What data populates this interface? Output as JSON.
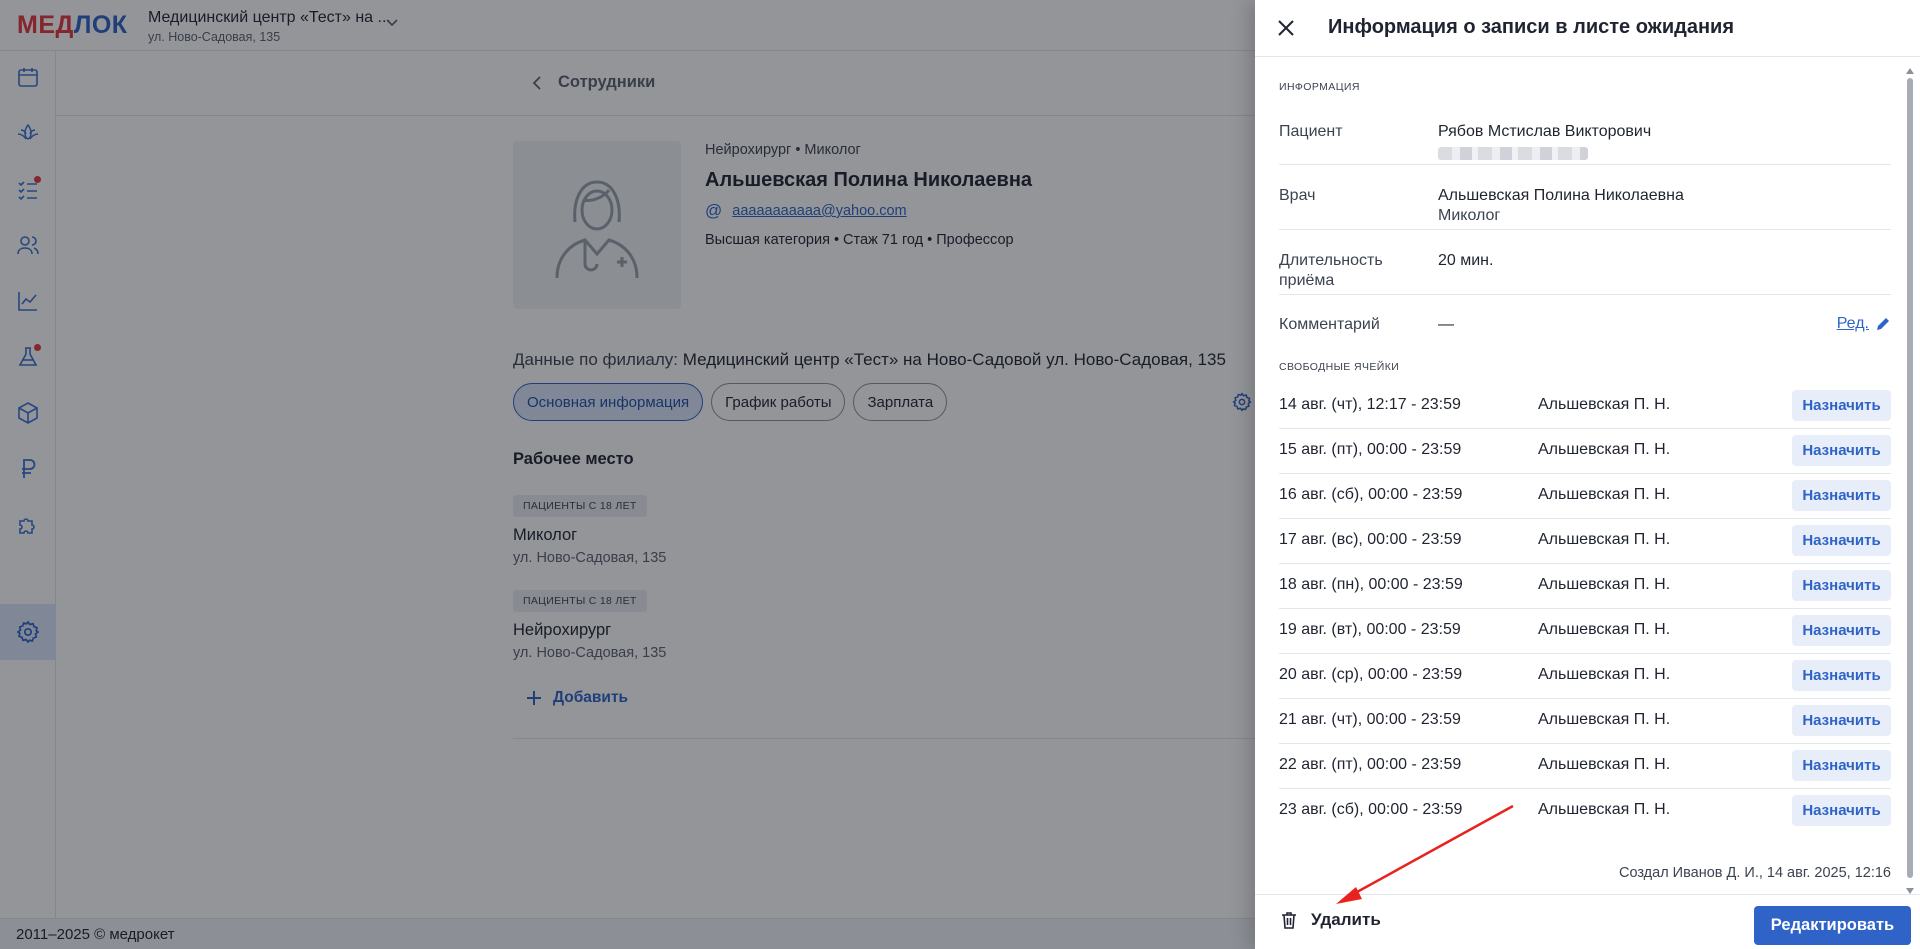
{
  "app": {
    "logo_part1": "МЕД",
    "logo_part2": "ЛОК",
    "clinic_name": "Медицинский центр «Тест» на ...",
    "clinic_address": "ул. Ново-Садовая, 135",
    "footer_text": "2011–2025 © медрокет"
  },
  "sidebar": {
    "icons": [
      "calendar-icon",
      "lotus-icon",
      "task-list-icon",
      "users-icon",
      "chart-icon",
      "flask-icon",
      "box-icon",
      "ruble-icon",
      "puzzle-icon",
      "settings-icon"
    ],
    "active": "settings-icon",
    "badges": [
      "task-list-icon",
      "flask-icon"
    ]
  },
  "employee": {
    "breadcrumb": "Сотрудники",
    "specialties": "Нейрохирург • Миколог",
    "name": "Альшевская Полина Николаевна",
    "email": "aaaaaaaaaaa@yahoo.com",
    "meta": "Высшая категория • Стаж 71 год • Профессор",
    "branch_label": "Данные по филиалу:",
    "branch_value": "Медицинский центр «Тест» на Ново-Садовой ул. Ново-Садовая, 135",
    "tabs": [
      "Основная информация",
      "График работы",
      "Зарплата"
    ],
    "workplace_title": "Рабочее место",
    "workplaces": [
      {
        "badge": "ПАЦИЕНТЫ С 18 ЛЕТ",
        "title": "Миколог",
        "address": "ул. Ново-Садовая, 135"
      },
      {
        "badge": "ПАЦИЕНТЫ С 18 ЛЕТ",
        "title": "Нейрохирург",
        "address": "ул. Ново-Садовая, 135"
      }
    ],
    "add_label": "Добавить"
  },
  "drawer": {
    "title": "Информация о записи в листе ожидания",
    "info_label": "ИНФОРМАЦИЯ",
    "patient_key": "Пациент",
    "patient_value": "Рябов Мстислав Викторович",
    "doctor_key": "Врач",
    "doctor_value": "Альшевская Полина Николаевна",
    "doctor_spec": "Миколог",
    "duration_key": "Длительность приёма",
    "duration_value": "20 мин.",
    "comment_key": "Комментарий",
    "comment_value": "—",
    "edit_label": "Ред.",
    "slots_label": "СВОБОДНЫЕ ЯЧЕЙКИ",
    "slots": [
      {
        "date": "14 авг. (чт), 12:17 - 23:59",
        "doctor": "Альшевская П. Н.",
        "action": "Назначить"
      },
      {
        "date": "15 авг. (пт), 00:00 - 23:59",
        "doctor": "Альшевская П. Н.",
        "action": "Назначить"
      },
      {
        "date": "16 авг. (сб), 00:00 - 23:59",
        "doctor": "Альшевская П. Н.",
        "action": "Назначить"
      },
      {
        "date": "17 авг. (вс), 00:00 - 23:59",
        "doctor": "Альшевская П. Н.",
        "action": "Назначить"
      },
      {
        "date": "18 авг. (пн), 00:00 - 23:59",
        "doctor": "Альшевская П. Н.",
        "action": "Назначить"
      },
      {
        "date": "19 авг. (вт), 00:00 - 23:59",
        "doctor": "Альшевская П. Н.",
        "action": "Назначить"
      },
      {
        "date": "20 авг. (ср), 00:00 - 23:59",
        "doctor": "Альшевская П. Н.",
        "action": "Назначить"
      },
      {
        "date": "21 авг. (чт), 00:00 - 23:59",
        "doctor": "Альшевская П. Н.",
        "action": "Назначить"
      },
      {
        "date": "22 авг. (пт), 00:00 - 23:59",
        "doctor": "Альшевская П. Н.",
        "action": "Назначить"
      },
      {
        "date": "23 авг. (сб), 00:00 - 23:59",
        "doctor": "Альшевская П. Н.",
        "action": "Назначить"
      }
    ],
    "created": "Создал Иванов Д. И., 14 авг. 2025, 12:16",
    "delete_label": "Удалить",
    "primary_label": "Редактировать"
  },
  "colors": {
    "accent": "#2f63c7",
    "brand_red": "#e5333b",
    "annotation_arrow": "#e8231f"
  }
}
